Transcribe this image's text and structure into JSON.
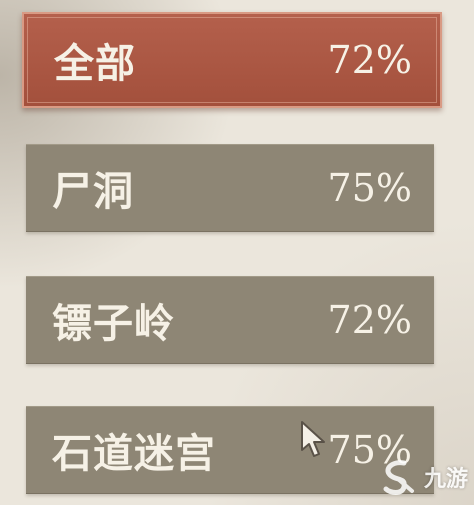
{
  "tabs": [
    {
      "name": "全部",
      "percent": "72%"
    },
    {
      "name": "尸洞",
      "percent": "75%"
    },
    {
      "name": "镖子岭",
      "percent": "72%"
    },
    {
      "name": "石道迷宫",
      "percent": "75%"
    }
  ],
  "watermark": {
    "text": "九游"
  },
  "icons": {
    "cursor": "pointer-cursor-icon",
    "logo": "jiuyou-logo-icon"
  },
  "colors": {
    "selected": "#a8553f",
    "unselected": "#8e8675",
    "text": "#f6f1e6",
    "background": "#ebe6dc"
  }
}
